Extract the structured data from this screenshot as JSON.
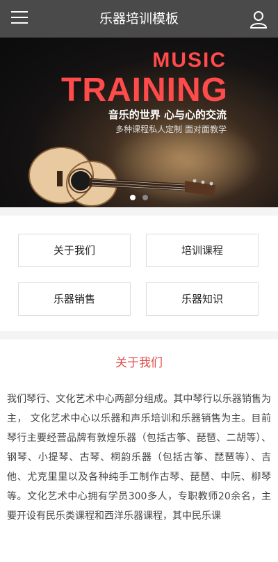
{
  "header": {
    "title": "乐器培训模板",
    "menu_icon": "menu-icon",
    "user_icon": "user-icon"
  },
  "banner": {
    "music_text": "MUSIC",
    "training_text": "TRAINING",
    "slogan": "音乐的世界 心与心的交流",
    "subtitle": "多种课程私人定制 面对面教学",
    "accent_color": "#ff4b4b",
    "slide_count": 2,
    "active_slide": 1
  },
  "nav": {
    "items": [
      {
        "label": "关于我们"
      },
      {
        "label": "培训课程"
      },
      {
        "label": "乐器销售"
      },
      {
        "label": "乐器知识"
      }
    ]
  },
  "about": {
    "title": "关于我们",
    "title_color": "#e24d4d",
    "text": "我们琴行、文化艺术中心两部分组成。其中琴行以乐器销售为主， 文化艺术中心以乐器和声乐培训和乐器销售为主。目前琴行主要经营品牌有敦煌乐器（包括古筝、琵琶、二胡等）、钢琴、小提琴、古琴、桐韵乐器（包括古筝、琵琶等）、吉他、尤克里里以及各种纯手工制作古琴、琵琶、中阮、柳琴等。文化艺术中心拥有学员300多人，专职教师20余名，主要开设有民乐类课程和西洋乐器课程，其中民乐课"
  }
}
